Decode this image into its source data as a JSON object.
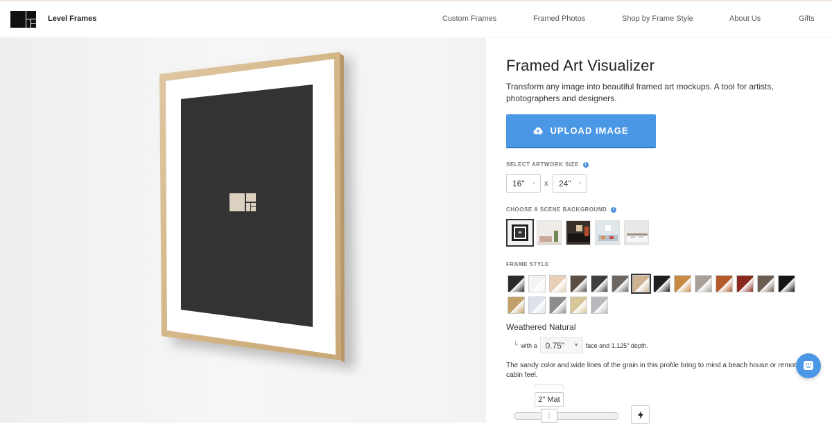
{
  "header": {
    "brand": "Level Frames",
    "nav": [
      "Custom Frames",
      "Framed Photos",
      "Shop by Frame Style",
      "About Us",
      "Gifts"
    ]
  },
  "panel": {
    "title": "Framed Art Visualizer",
    "description": "Transform any image into beautiful framed art mockups. A tool for artists, photographers and designers.",
    "upload_label": "UPLOAD IMAGE",
    "size_label": "SELECT ARTWORK SIZE",
    "width_value": "16\"",
    "height_value": "24\"",
    "times": "x",
    "scene_label": "CHOOSE A SCENE BACKGROUND",
    "frame_style_label": "FRAME STYLE",
    "frame_name": "Weathered Natural",
    "face_prefix": "with a",
    "face_value": "0.75\"",
    "face_suffix": "face and 1.125\" depth.",
    "profile_description": "The sandy color and wide lines of the grain in this profile bring to mind a beach house or remote cabin feel.",
    "mat_value": "2\" Mat"
  },
  "colors": {
    "accent": "#4a97e6",
    "frame_wood": "#d9bc93",
    "artwork": "#333333"
  },
  "swatches": [
    {
      "name": "black",
      "color": "#2b2b2b",
      "selected": false
    },
    {
      "name": "white",
      "color": "#f3f3f3",
      "selected": false
    },
    {
      "name": "natural-light",
      "color": "#e8cfb5",
      "selected": false
    },
    {
      "name": "walnut-dark",
      "color": "#5a4d42",
      "selected": false
    },
    {
      "name": "charcoal",
      "color": "#3e3e3e",
      "selected": false
    },
    {
      "name": "gray-wood",
      "color": "#6d6661",
      "selected": false
    },
    {
      "name": "weathered-natural",
      "color": "#cfb390",
      "selected": true
    },
    {
      "name": "black-metal",
      "color": "#1f1f1f",
      "selected": false
    },
    {
      "name": "honey",
      "color": "#c88a45",
      "selected": false
    },
    {
      "name": "gray-barn",
      "color": "#a8a09a",
      "selected": false
    },
    {
      "name": "cherry-light",
      "color": "#b45a2a",
      "selected": false
    },
    {
      "name": "cherry-red",
      "color": "#8a2a1e",
      "selected": false
    },
    {
      "name": "espresso-gray",
      "color": "#6c5d52",
      "selected": false
    },
    {
      "name": "matte-black",
      "color": "#151515",
      "selected": false
    },
    {
      "name": "oak",
      "color": "#c2a06a",
      "selected": false
    },
    {
      "name": "silver-light",
      "color": "#dde2ea",
      "selected": false
    },
    {
      "name": "pewter",
      "color": "#8e8c8a",
      "selected": false
    },
    {
      "name": "gold-light",
      "color": "#d7c69a",
      "selected": false
    },
    {
      "name": "silver-gray",
      "color": "#b9b9bd",
      "selected": false
    }
  ]
}
